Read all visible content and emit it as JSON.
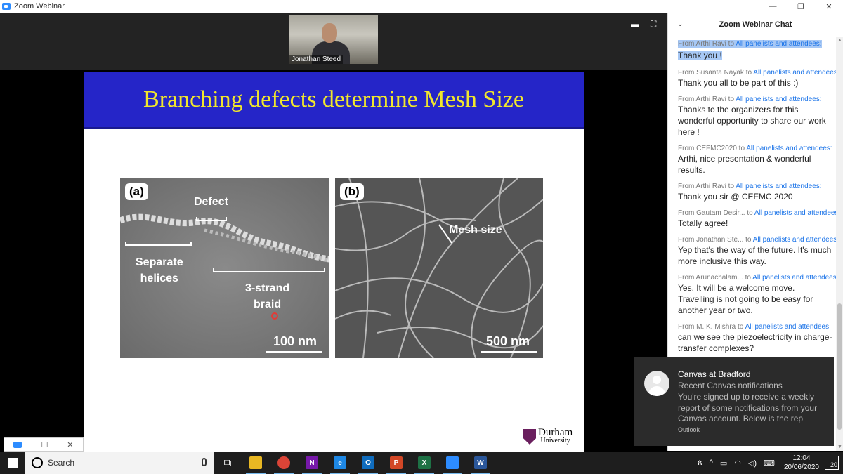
{
  "window": {
    "title": "Zoom Webinar",
    "minimize": "—",
    "maximize": "❐",
    "close": "✕"
  },
  "video": {
    "participant_name": "Jonathan Steed",
    "view_icon": "speaker-view-icon",
    "fullscreen_icon": "fullscreen-icon"
  },
  "slide": {
    "title": "Branching defects determine Mesh Size",
    "panel_a": {
      "label": "(a)",
      "defect": "Defect",
      "separate": "Separate\nhelices",
      "braid": "3-strand\nbraid",
      "scale": "100 nm"
    },
    "panel_b": {
      "label": "(b)",
      "mesh": "Mesh size",
      "scale": "500 nm"
    },
    "logo": {
      "name": "Durham",
      "sub": "University"
    }
  },
  "chat": {
    "title": "Zoom Webinar Chat",
    "messages": [
      {
        "from": "From Arthi Ravi to ",
        "to": "All panelists and attendees:",
        "text": "Thank you !",
        "selected": true
      },
      {
        "from": "From Susanta Nayak to ",
        "to": "All panelists and attendees:",
        "text": "Thank you all to be part of this :)"
      },
      {
        "from": "From Arthi Ravi to ",
        "to": "All panelists and attendees:",
        "text": "Thanks to the organizers for this wonderful opportunity to share our work here !"
      },
      {
        "from": "From CEFMC2020 to ",
        "to": "All panelists and attendees:",
        "text": "Arthi, nice presentation & wonderful results."
      },
      {
        "from": "From Arthi Ravi to ",
        "to": "All panelists and attendees:",
        "text": "Thank you sir @ CEFMC 2020"
      },
      {
        "from": "From Gautam Desir... to ",
        "to": "All panelists and attendees:",
        "text": "Totally agree!"
      },
      {
        "from": "From Jonathan Ste...  to ",
        "to": "All panelists and attendees:",
        "text": "Yep that's the way of the future. It's much more inclusive this way."
      },
      {
        "from": "From Arunachalam...  to ",
        "to": "All panelists and attendees:",
        "text": "Yes. It will be a welcome move. Travelling is not going to be easy for another year or two."
      },
      {
        "from": "From M. K. Mishra to ",
        "to": "All panelists and attendees:",
        "text": "can we see the piezoelectricity in charge-transfer complexes?"
      }
    ]
  },
  "notification": {
    "title": "Canvas at Bradford",
    "subtitle": "Recent Canvas notifications",
    "body": "You're signed up to receive a weekly report of some notifications from your Canvas account. Below is the rep",
    "source": "Outlook"
  },
  "taskbar": {
    "search_placeholder": "Search",
    "apps": [
      {
        "name": "task-view-icon",
        "glyph": "⧉",
        "color": "transparent"
      },
      {
        "name": "file-explorer-icon",
        "glyph": "",
        "color": "#e8b723"
      },
      {
        "name": "chrome-icon",
        "glyph": "",
        "color": "#db4437"
      },
      {
        "name": "onenote-icon",
        "glyph": "N",
        "color": "#7719aa"
      },
      {
        "name": "edge-icon",
        "glyph": "e",
        "color": "#1e88e5"
      },
      {
        "name": "outlook-icon",
        "glyph": "O",
        "color": "#0f6cbd"
      },
      {
        "name": "powerpoint-icon",
        "glyph": "P",
        "color": "#d24726"
      },
      {
        "name": "excel-icon",
        "glyph": "X",
        "color": "#1e7145"
      },
      {
        "name": "zoom-icon",
        "glyph": "",
        "color": "#2d8cff"
      },
      {
        "name": "word-icon",
        "glyph": "W",
        "color": "#2b579a"
      }
    ],
    "time": "12:04",
    "date": "20/06/2020",
    "notif_count": "20"
  }
}
